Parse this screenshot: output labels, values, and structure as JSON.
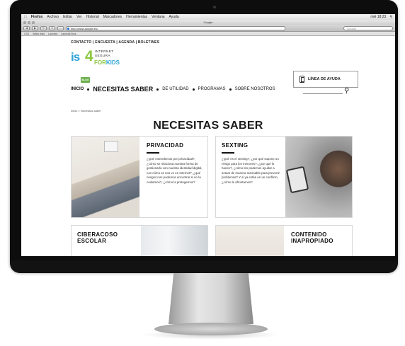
{
  "menubar": {
    "app": "Firefox",
    "items": [
      "Archivo",
      "Editar",
      "Ver",
      "Historial",
      "Marcadores",
      "Herramientas",
      "Ventana",
      "Ayuda"
    ],
    "clock": "mié 18:23"
  },
  "window": {
    "title": "Google"
  },
  "toolbar": {
    "url": "http://www.google.es/",
    "search_placeholder": "Google"
  },
  "bookmarks": [
    "CSS",
    "Webs links",
    "Lancelot",
    "Lancelot links"
  ],
  "site": {
    "topnav": "CONTACTO | ENCUESTA | AGENDA | BOLETINES",
    "logo": {
      "is": "is",
      "four": "4",
      "k": "k",
      "internet_lines": [
        "INTERNET",
        "SEGURA"
      ],
      "for_kids": [
        "FOR",
        "KIDS"
      ]
    },
    "help_label": "LÍNEA DE AYUDA",
    "blog_badge": "BLOG",
    "nav": {
      "inicio": "INICIO",
      "necesitas": "NECESITAS SABER",
      "utilidad": "DE UTILIDAD",
      "programas": "PROGRAMAS",
      "sobre": "SOBRE NOSOTROS"
    },
    "breadcrumb": "Inicio > Necesitas saber",
    "heading": "NECESITAS SABER",
    "cards": {
      "privacidad": {
        "title": "PRIVACIDAD",
        "body": "¿Qué entendemos por privacidad?, ¿cómo se relaciona nuestra forma de gestionarla con nuestra identidad digital, con cómo se nos ve en Internet?, ¿qué riesgos nos podemos encontrar si no la cuidamos?, ¿cómo la protegemos?"
      },
      "sexting": {
        "title": "SEXTING",
        "body": "¿Qué es el sexting?, ¿por qué supone un riesgo para los menores?, ¿por qué lo hacen?, ¿cómo les podemos ayudar a actuar de manera razonable para prevenir problemas? Y si ya están en un conflicto, ¿cómo le afrontamos?"
      },
      "ciberacoso": {
        "title_lines": [
          "CIBERACOSO",
          "ESCOLAR"
        ]
      },
      "contenido": {
        "title_lines": [
          "CONTENIDO",
          "INAPROPIADO"
        ]
      }
    }
  },
  "colors": {
    "brand_blue": "#2fa4d6",
    "brand_green": "#8cc63f",
    "blog_green": "#6ab04c",
    "text_dark": "#1a1a1a"
  },
  "icons": [
    "apple-icon",
    "search-icon",
    "phone-icon",
    "back-icon",
    "forward-icon",
    "reload-icon",
    "home-icon"
  ]
}
